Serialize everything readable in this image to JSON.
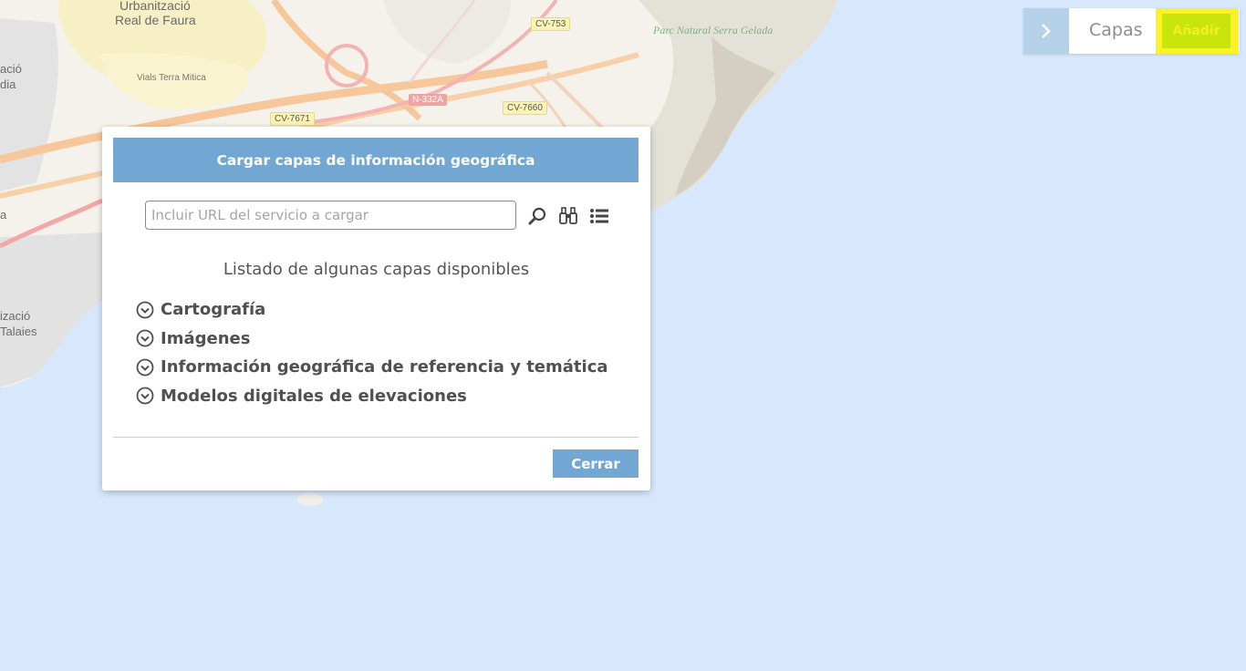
{
  "map": {
    "places": {
      "urbanitzacio_faura": "Urbanització",
      "real_de_faura": "Real de Faura",
      "vials_terra_mitica": "Vials Terra Mitica",
      "parc_natural": "Parc Natural Serra Gelada",
      "partial_1": "ació",
      "partial_2": "dia",
      "partial_3": "a",
      "partial_4": "izació",
      "partial_5": "Talaies"
    },
    "roads": {
      "cv753": "CV-753",
      "n332a": "N-332A",
      "cv7660": "CV-7660",
      "cv7671": "CV-7671"
    }
  },
  "topbar": {
    "toggle_icon": "chevron-right-icon",
    "capas_label": "Capas",
    "anadir_label": "Añadir",
    "highlight_color": "#fbf22a"
  },
  "dialog": {
    "title": "Cargar capas de información geográfica",
    "url_placeholder": "Incluir URL del servicio a cargar",
    "url_value": "",
    "tools": [
      "search-icon",
      "binoculars-icon",
      "list-icon"
    ],
    "list_title": "Listado de algunas capas disponibles",
    "layers": [
      "Cartografía",
      "Imágenes",
      "Información geográfica de referencia y temática",
      "Modelos digitales de elevaciones"
    ],
    "close_label": "Cerrar",
    "accent_color": "#73a7d3"
  }
}
